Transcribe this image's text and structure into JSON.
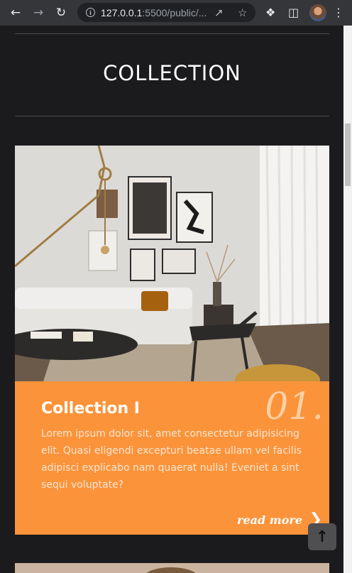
{
  "browser": {
    "url_host": "127.0.0.1",
    "url_path": ":5500/public/...",
    "back_icon": "back-arrow-icon",
    "forward_icon": "forward-arrow-icon",
    "reload_icon": "reload-icon"
  },
  "page": {
    "title": "COLLECTION",
    "card": {
      "number": "01.",
      "title": "Collection I",
      "text": "Lorem ipsum dolor sit, amet consectetur adipisicing elit. Quasi eligendi excepturi beatae ullam vel facilis adipisci explicabo nam quaerat nulla! Eveniet a sint sequi voluptate?",
      "read_more": "read more"
    },
    "back_to_top_icon": "arrow-up-icon",
    "accent_color": "#fb933a"
  }
}
